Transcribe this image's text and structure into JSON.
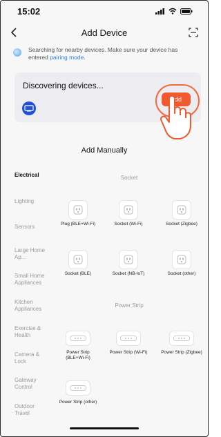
{
  "status_bar": {
    "time": "15:02"
  },
  "header": {
    "title": "Add Device"
  },
  "search": {
    "message": "Searching for nearby devices. Make sure your device has entered ",
    "link": "pairing mode",
    "suffix": "."
  },
  "discovery": {
    "label": "Discovering devices...",
    "add_label": "Add"
  },
  "manual": {
    "title": "Add Manually"
  },
  "categories": [
    "Electrical",
    "Lighting",
    "Sensors",
    "Large Home Ap...",
    "Small Home Appliances",
    "Kitchen Appliances",
    "Exercise & Health",
    "Camera & Lock",
    "Gateway Control",
    "Outdoor Travel"
  ],
  "sections": {
    "socket": "Socket",
    "power_strip": "Power Strip"
  },
  "socket_items": [
    "Plug (BLE+Wi-Fi)",
    "Socket (Wi-Fi)",
    "Socket (Zigbee)",
    "Socket (BLE)",
    "Socket (NB-IoT)",
    "Socket (other)"
  ],
  "strip_items": [
    "Power Strip (BLE+Wi-Fi)",
    "Power Strip (Wi-Fi)",
    "Power Strip (Zigbee)",
    "Power Strip (other)"
  ],
  "icons": {
    "back": "chevron-left-icon",
    "scan": "scan-icon",
    "device": "device-icon",
    "socket": "socket-icon",
    "strip": "power-strip-icon"
  },
  "colors": {
    "accent": "#ef5a2e",
    "link": "#2f7de1"
  }
}
